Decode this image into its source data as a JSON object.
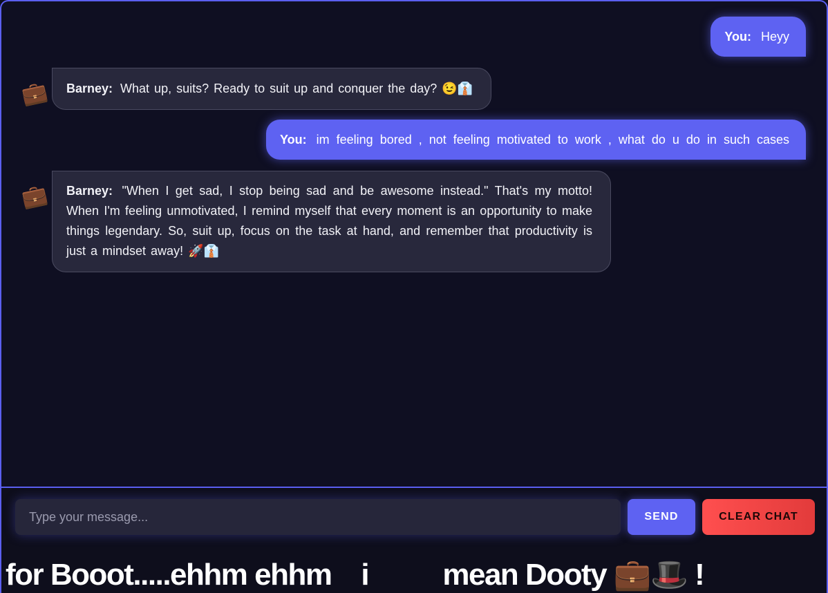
{
  "messages": [
    {
      "sender": "user",
      "speaker": "You:",
      "text": "Heyy"
    },
    {
      "sender": "bot",
      "speaker": "Barney:",
      "text": "What up, suits? Ready to suit up and conquer the day? 😉👔",
      "avatar_icon": "briefcase-icon"
    },
    {
      "sender": "user",
      "speaker": "You:",
      "text": "im feeling bored , not feeling motivated to work , what do u do in such cases"
    },
    {
      "sender": "bot",
      "speaker": "Barney:",
      "text": "\"When I get sad, I stop being sad and be awesome instead.\" That's my motto! When I'm feeling unmotivated, I remind myself that every moment is an opportunity to make things legendary. So, suit up, focus on the task at hand, and remember that productivity is just a mindset away! 🚀👔",
      "avatar_icon": "briefcase-icon"
    }
  ],
  "avatar_glyph": "💼",
  "composer": {
    "placeholder": "Type your message...",
    "send_label": "SEND",
    "clear_label": "CLEAR CHAT"
  },
  "ticker": {
    "text": "for Booot.....ehhm ehhm    i          mean Dooty 💼🎩 !"
  },
  "colors": {
    "accent": "#5e62f2",
    "bot_bubble": "#28283c",
    "clear_button": "#ff4f4f",
    "background": "#0f0f22"
  }
}
